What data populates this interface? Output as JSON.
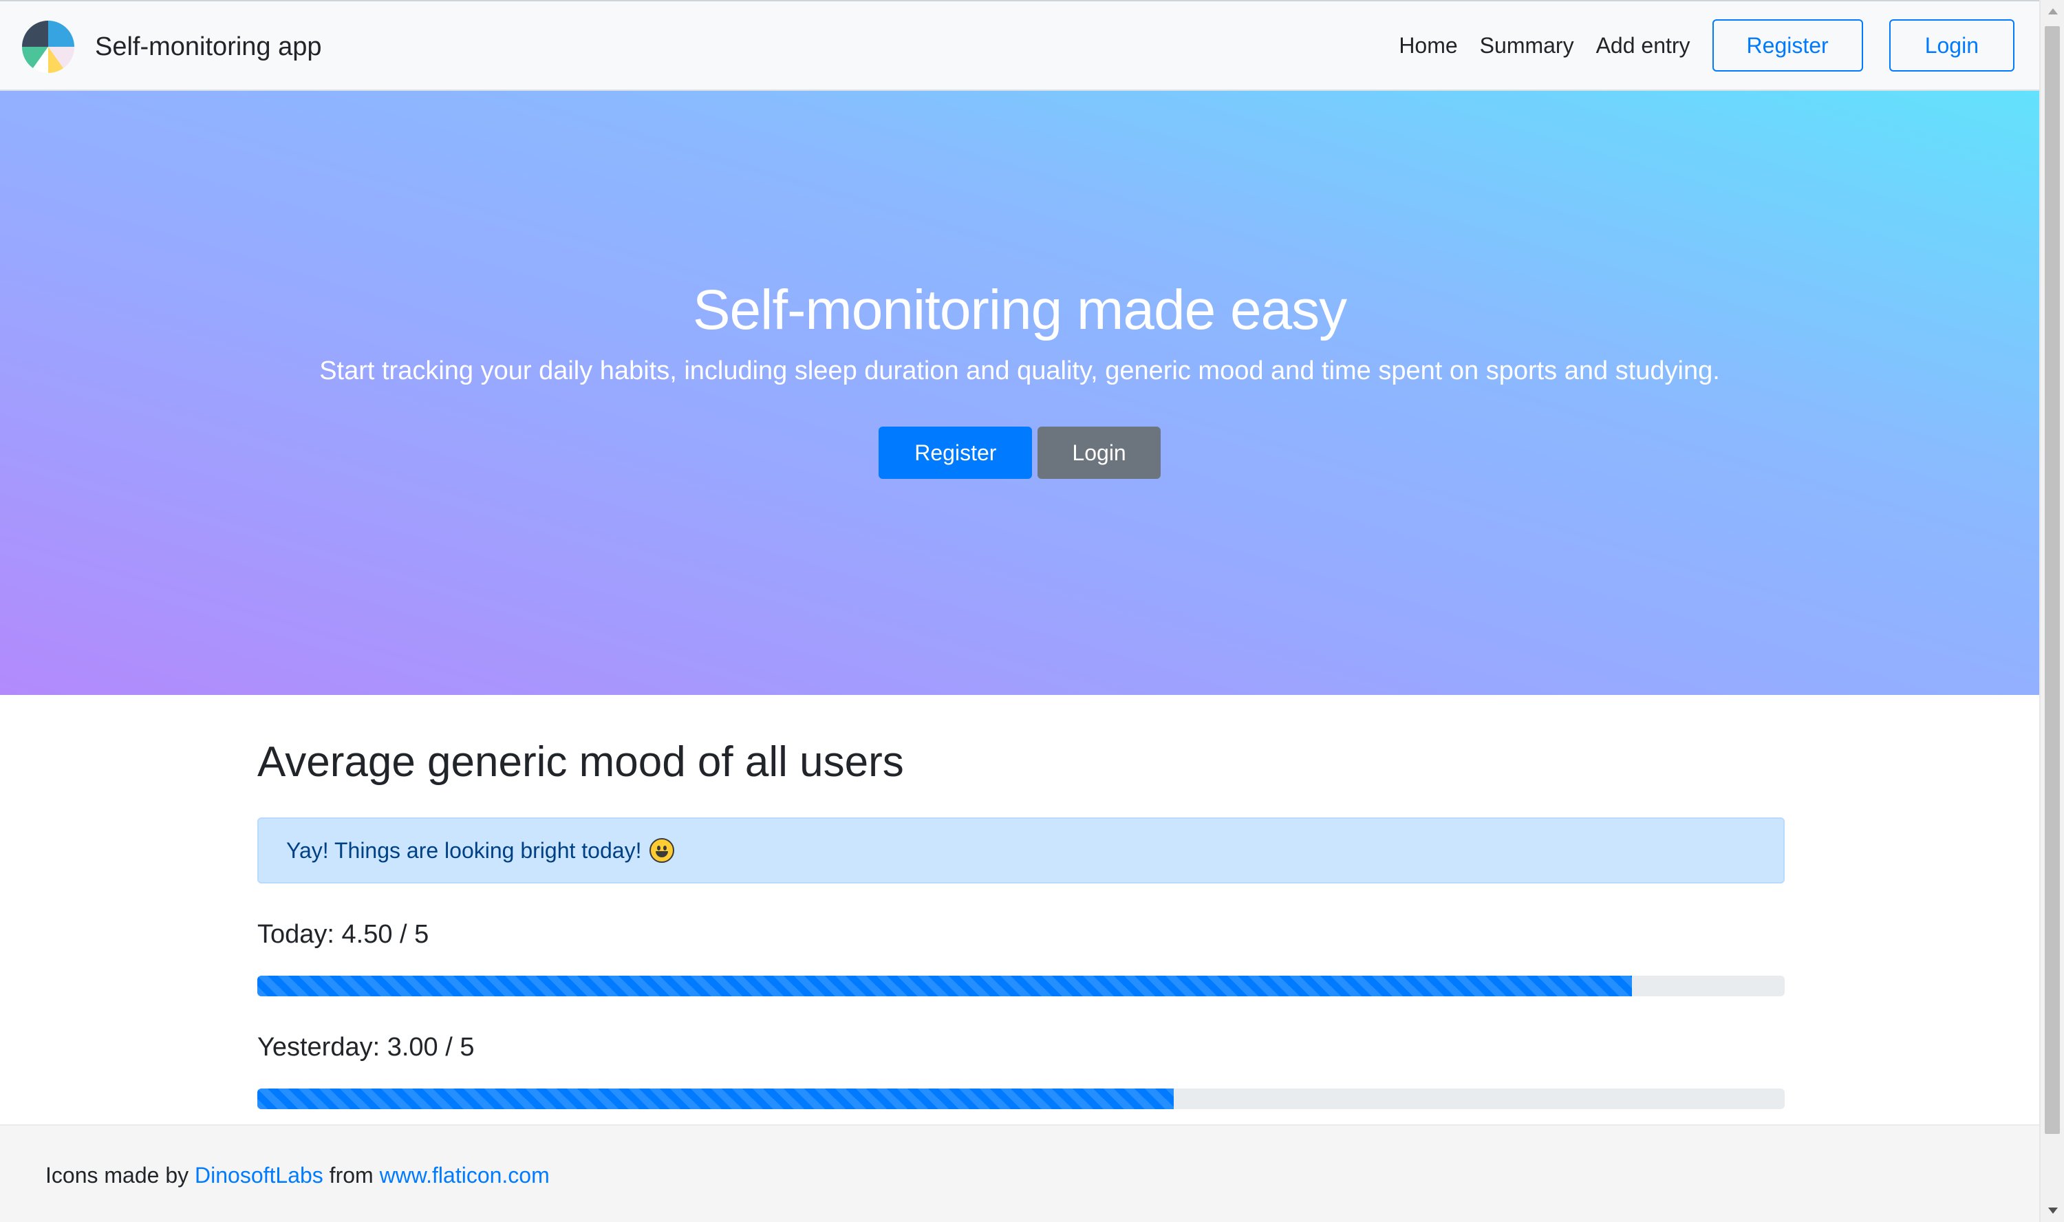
{
  "navbar": {
    "brand_name": "Self-monitoring app",
    "logo_icon": "pie-chart-logo",
    "links": [
      "Home",
      "Summary",
      "Add entry"
    ],
    "register_label": "Register",
    "login_label": "Login"
  },
  "hero": {
    "title": "Self-monitoring made easy",
    "subtitle": "Start tracking your daily habits, including sleep duration and quality, generic mood and time spent on sports and studying.",
    "register_label": "Register",
    "login_label": "Login"
  },
  "main": {
    "title": "Average generic mood of all users",
    "alert_text": "Yay! Things are looking bright today!",
    "alert_icon": "smiley-face-emoji",
    "stats": [
      {
        "label": "Today: 4.50 / 5",
        "value": 4.5,
        "max": 5
      },
      {
        "label": "Yesterday: 3.00 / 5",
        "value": 3.0,
        "max": 5
      }
    ]
  },
  "footer": {
    "prefix": "Icons made by",
    "author_link": "DinosoftLabs",
    "middle": "from",
    "site_link": "www.flaticon.com"
  },
  "colors": {
    "primary": "#007bff",
    "secondary": "#6c757d",
    "alert_bg": "#cce5ff",
    "alert_text": "#004085",
    "hero_gradient_start": "#b28afc",
    "hero_gradient_end": "#62e2fc"
  }
}
